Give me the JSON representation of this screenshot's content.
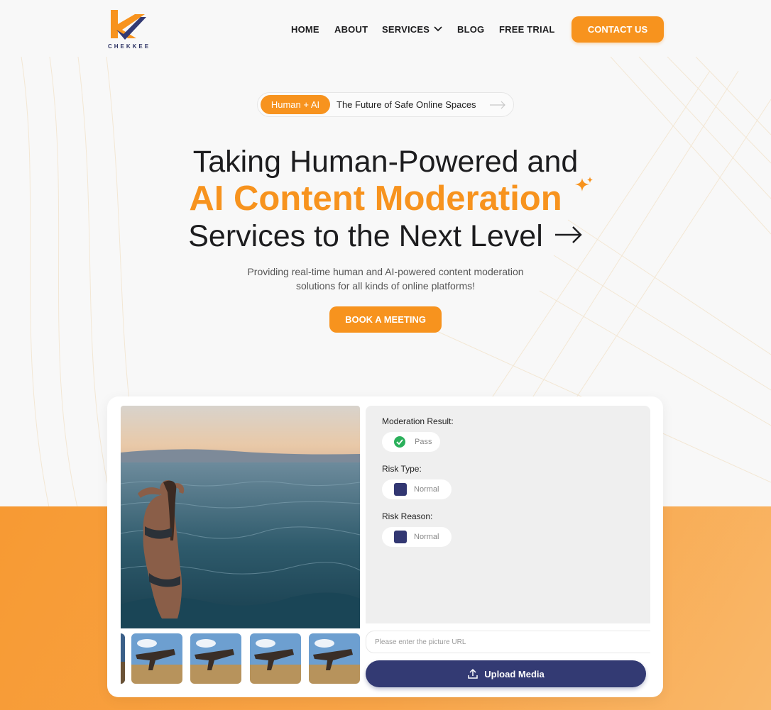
{
  "brand": {
    "name": "CHEKKEE",
    "accent": "#f7931e",
    "navy": "#333a73"
  },
  "nav": {
    "items": [
      "HOME",
      "ABOUT",
      "SERVICES",
      "BLOG",
      "FREE TRIAL"
    ],
    "contact_label": "CONTACT US"
  },
  "hero": {
    "pill_tag": "Human + AI",
    "pill_text": "The Future of Safe Online Spaces",
    "line1": "Taking Human-Powered and",
    "line2": "AI Content Moderation",
    "line3": "Services to the Next Level",
    "subtitle_1": "Providing real-time human and AI-powered content moderation",
    "subtitle_2": "solutions for all kinds of online platforms!",
    "cta": "BOOK A MEETING"
  },
  "demo": {
    "result_label": "Moderation Result:",
    "result_value": "Pass",
    "risk_type_label": "Risk Type:",
    "risk_type_value": "Normal",
    "risk_reason_label": "Risk Reason:",
    "risk_reason_value": "Normal",
    "url_placeholder": "Please enter the picture URL",
    "upload_label": "Upload Media"
  }
}
